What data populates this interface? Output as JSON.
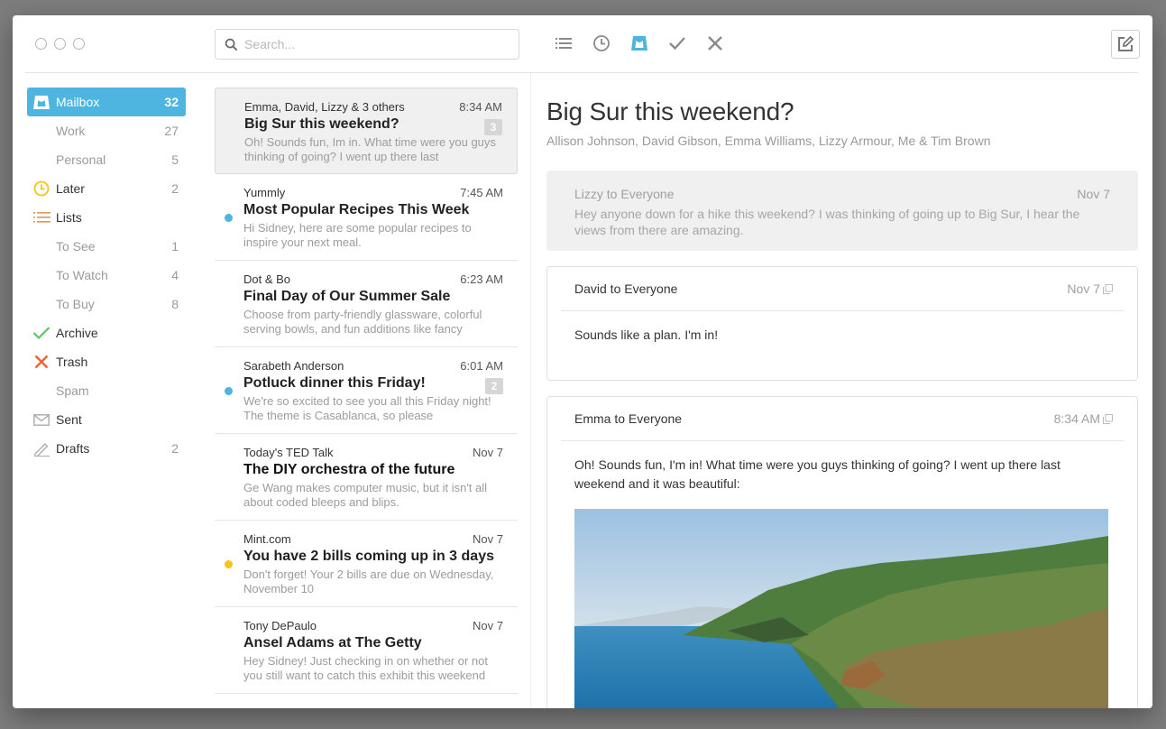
{
  "window": {
    "traffic_lights": [
      "close",
      "minimize",
      "zoom"
    ]
  },
  "search": {
    "placeholder": "Search...",
    "value": "",
    "icon": "search-icon"
  },
  "toolbar": {
    "actions": [
      {
        "name": "list",
        "icon": "list-icon"
      },
      {
        "name": "later",
        "icon": "clock-icon"
      },
      {
        "name": "mailbox",
        "icon": "mailbox-icon",
        "active": true
      },
      {
        "name": "archive",
        "icon": "check-icon"
      },
      {
        "name": "delete",
        "icon": "x-icon"
      }
    ],
    "compose_icon": "compose-icon"
  },
  "colors": {
    "accent": "#4eb5e0",
    "later": "#f5c518",
    "lists": "#d49a5e",
    "archive": "#5cc85c",
    "trash": "#e8663a",
    "unread_blue": "#4eb5e0",
    "unread_yellow": "#f5c518"
  },
  "sidebar": {
    "items": [
      {
        "label": "Mailbox",
        "count": "32",
        "icon": "mailbox-icon",
        "active": true
      },
      {
        "label": "Work",
        "count": "27",
        "sub": true
      },
      {
        "label": "Personal",
        "count": "5",
        "sub": true
      },
      {
        "label": "Later",
        "count": "2",
        "icon": "clock-icon"
      },
      {
        "label": "Lists",
        "count": "",
        "icon": "list-icon"
      },
      {
        "label": "To See",
        "count": "1",
        "sub": true
      },
      {
        "label": "To Watch",
        "count": "4",
        "sub": true
      },
      {
        "label": "To Buy",
        "count": "8",
        "sub": true
      },
      {
        "label": "Archive",
        "count": "",
        "icon": "check-icon"
      },
      {
        "label": "Trash",
        "count": "",
        "icon": "x-icon"
      },
      {
        "label": "Spam",
        "count": "",
        "sub": true
      },
      {
        "label": "Sent",
        "count": "",
        "icon": "envelope-icon"
      },
      {
        "label": "Drafts",
        "count": "2",
        "icon": "pencil-icon"
      }
    ]
  },
  "messages": [
    {
      "from": "Emma, David, Lizzy & 3 others",
      "time": "8:34 AM",
      "subject": "Big Sur this weekend?",
      "preview": "Oh! Sounds fun, Im in. What time were you guys thinking of going? I went up there last",
      "badge": "3",
      "dot": "",
      "selected": true
    },
    {
      "from": "Yummly",
      "time": "7:45 AM",
      "subject": "Most Popular Recipes This Week",
      "preview": "Hi Sidney, here are some popular recipes to inspire your next meal.",
      "badge": "",
      "dot": "blue"
    },
    {
      "from": "Dot & Bo",
      "time": "6:23 AM",
      "subject": "Final Day of Our Summer Sale",
      "preview": "Choose from party-friendly glassware, colorful serving bowls, and fun additions like fancy",
      "badge": "",
      "dot": ""
    },
    {
      "from": "Sarabeth Anderson",
      "time": "6:01 AM",
      "subject": "Potluck dinner this Friday!",
      "preview": "We're so excited to see you all this Friday night! The theme is Casablanca, so please",
      "badge": "2",
      "dot": "blue"
    },
    {
      "from": "Today's TED Talk",
      "time": "Nov 7",
      "subject": "The DIY orchestra of the future",
      "preview": "Ge Wang makes computer music, but it isn't all about coded bleeps and blips.",
      "badge": "",
      "dot": ""
    },
    {
      "from": "Mint.com",
      "time": "Nov 7",
      "subject": "You have 2 bills coming up in 3 days",
      "preview": "Don't forget! Your 2 bills are due on Wednesday, November 10",
      "badge": "",
      "dot": "yellow"
    },
    {
      "from": "Tony DePaulo",
      "time": "Nov 7",
      "subject": "Ansel Adams at The Getty",
      "preview": "Hey Sidney! Just checking in on whether or not you still want to catch this exhibit this weekend",
      "badge": "",
      "dot": ""
    }
  ],
  "thread": {
    "title": "Big Sur this weekend?",
    "participants": "Allison Johnson, David Gibson, Emma Williams, Lizzy Armour, Me & Tim Brown",
    "collapsed": {
      "header": "Lizzy to Everyone",
      "date": "Nov 7",
      "body": "Hey anyone down for a hike this weekend? I was thinking of going up to Big Sur, I hear the views from there are amazing."
    },
    "messages": [
      {
        "header": "David to Everyone",
        "date": "Nov 7",
        "body": "Sounds like a plan. I'm in!"
      },
      {
        "header": "Emma to Everyone",
        "date": "8:34 AM",
        "body": "Oh! Sounds fun, I'm in! What time were you guys thinking of going? I went up there last weekend and it was beautiful:",
        "attachment": "Big Sur coastline photo"
      }
    ]
  }
}
